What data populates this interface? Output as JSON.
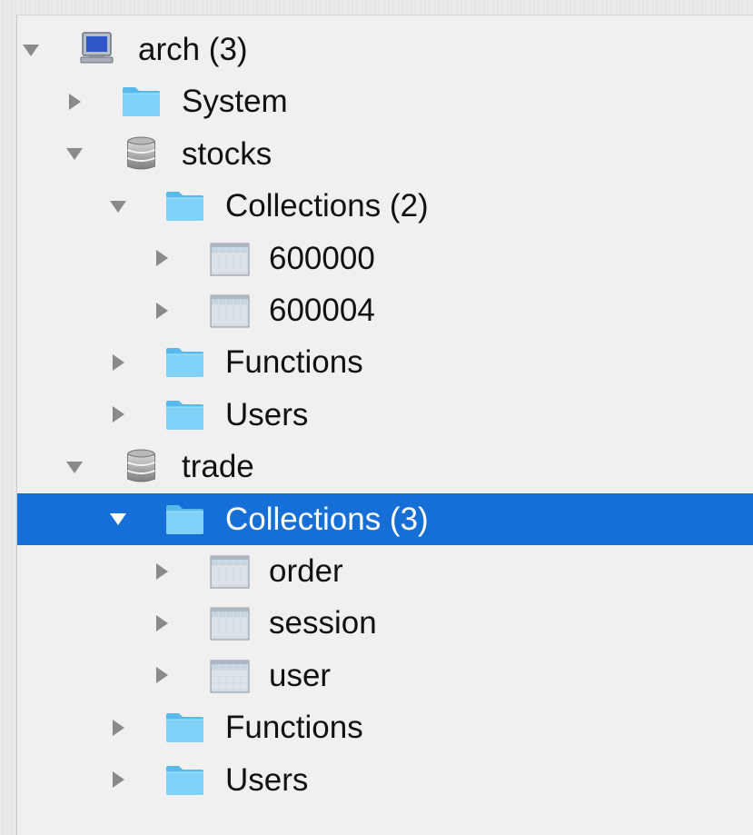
{
  "tree": {
    "items": [
      {
        "label": "arch (3)",
        "icon": "computer-icon",
        "state": "expanded",
        "level": 0
      },
      {
        "label": "System",
        "icon": "folder-icon",
        "state": "collapsed",
        "level": 1
      },
      {
        "label": "stocks",
        "icon": "database-icon",
        "state": "expanded",
        "level": 1
      },
      {
        "label": "Collections (2)",
        "icon": "folder-icon",
        "state": "expanded",
        "level": 2
      },
      {
        "label": "600000",
        "icon": "table-icon",
        "state": "collapsed",
        "level": 3
      },
      {
        "label": "600004",
        "icon": "table-icon",
        "state": "collapsed",
        "level": 3
      },
      {
        "label": "Functions",
        "icon": "folder-icon",
        "state": "collapsed",
        "level": 2
      },
      {
        "label": "Users",
        "icon": "folder-icon",
        "state": "collapsed",
        "level": 2
      },
      {
        "label": "trade",
        "icon": "database-icon",
        "state": "expanded",
        "level": 1
      },
      {
        "label": "Collections (3)",
        "icon": "folder-icon",
        "state": "expanded",
        "level": 2,
        "selected": true
      },
      {
        "label": "order",
        "icon": "table-icon",
        "state": "collapsed",
        "level": 3
      },
      {
        "label": "session",
        "icon": "table-icon",
        "state": "collapsed",
        "level": 3
      },
      {
        "label": "user",
        "icon": "table-icon",
        "state": "collapsed",
        "level": 3
      },
      {
        "label": "Functions",
        "icon": "folder-icon",
        "state": "collapsed",
        "level": 2
      },
      {
        "label": "Users",
        "icon": "folder-icon",
        "state": "collapsed",
        "level": 2
      }
    ]
  },
  "colors": {
    "selection": "#156fd6",
    "panel_background": "#f0f0f0",
    "folder": "#6ec8f4",
    "text": "#111111",
    "arrow": "#8a8a8a"
  }
}
